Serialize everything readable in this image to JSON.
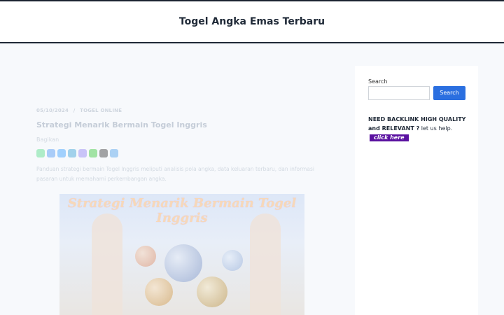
{
  "site": {
    "title": "Togel Angka Emas Terbaru"
  },
  "article": {
    "date": "05/10/2024",
    "separator": "/",
    "category": "TOGEL ONLINE",
    "title": "Strategi Menarik Bermain Togel Inggris",
    "share_label": "Bagikan",
    "share_icons": [
      "whatsapp-icon",
      "facebook-icon",
      "messenger-icon",
      "telegram-icon",
      "viber-icon",
      "line-icon",
      "x-icon",
      "share-icon"
    ],
    "share_colors": [
      "#25d366",
      "#1877f2",
      "#0084ff",
      "#0088cc",
      "#7360f2",
      "#00b900",
      "#000000",
      "#1e88e5"
    ],
    "excerpt": "Panduan strategi bermain Togel Inggris meliputi analisis pola angka, data keluaran terbaru, dan informasi pasaran untuk memahami perkembangan angka.",
    "image_text": "Strategi Menarik Bermain Togel Inggris"
  },
  "sidebar": {
    "search_label": "Search",
    "search_placeholder": "",
    "search_button": "Search",
    "backlink_bold": "NEED BACKLINK HIGH QUALITY and RELEVANT ?",
    "backlink_text": " let us help.",
    "click_here": "click here"
  }
}
